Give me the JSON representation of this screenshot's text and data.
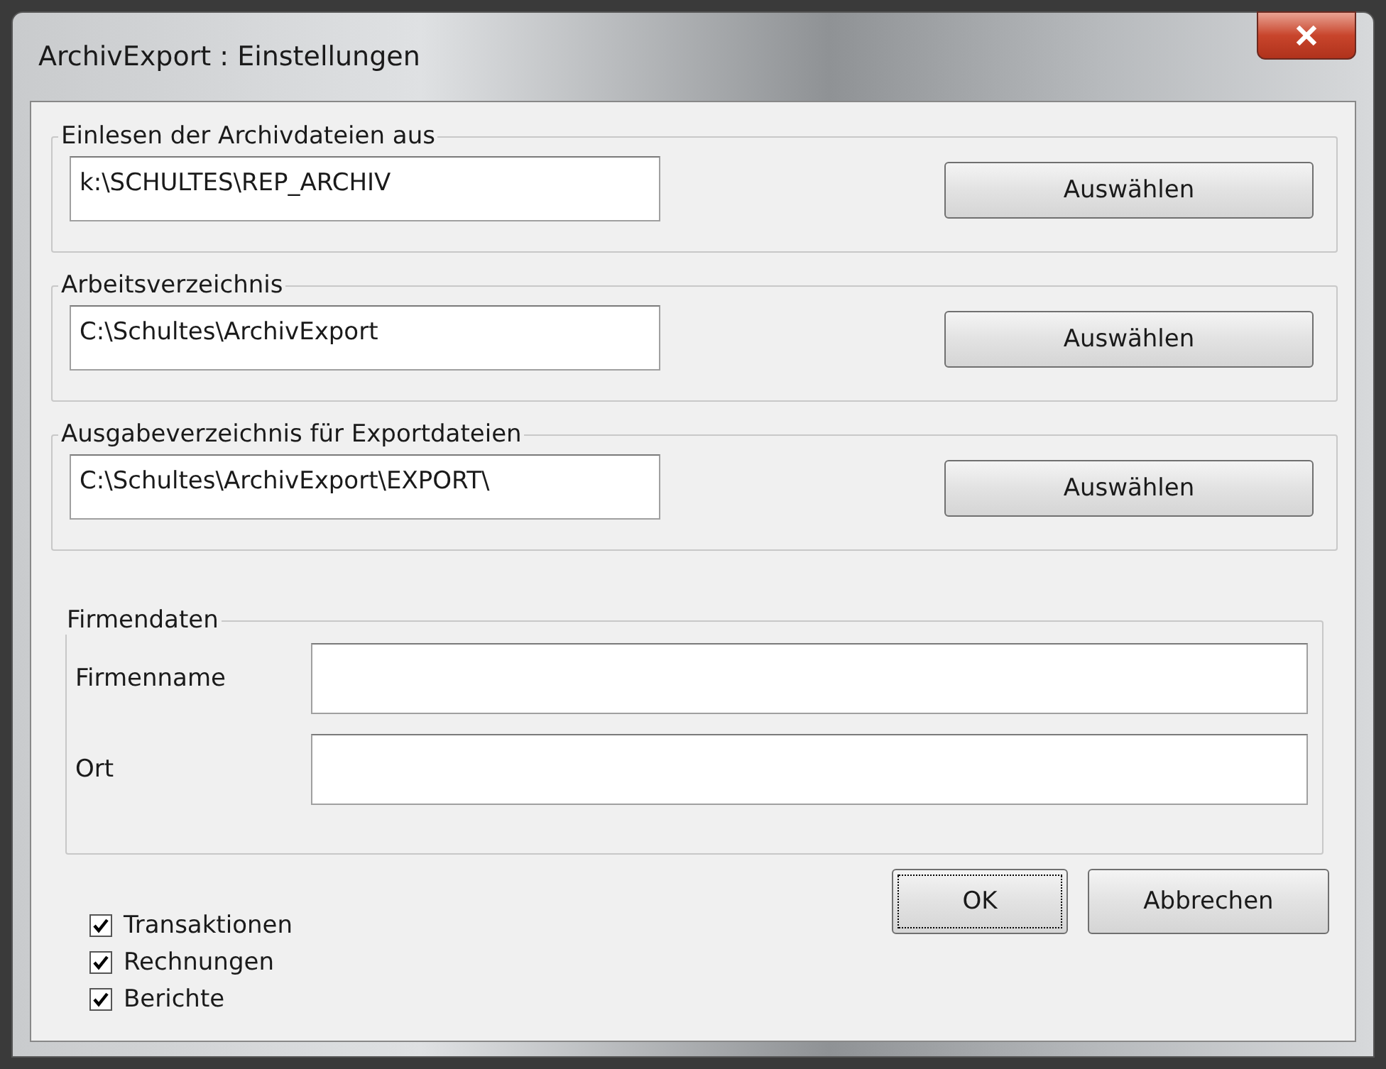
{
  "window": {
    "title": "ArchivExport : Einstellungen"
  },
  "folders": [
    {
      "label": "Einlesen der Archivdateien aus",
      "value": "k:\\SCHULTES\\REP_ARCHIV",
      "button": "Auswählen"
    },
    {
      "label": "Arbeitsverzeichnis",
      "value": "C:\\Schultes\\ArchivExport",
      "button": "Auswählen"
    },
    {
      "label": "Ausgabeverzeichnis für Exportdateien",
      "value": "C:\\Schultes\\ArchivExport\\EXPORT\\",
      "button": "Auswählen"
    }
  ],
  "company": {
    "title": "Firmendaten",
    "fields": [
      {
        "label": "Firmenname"
      },
      {
        "label": "Ort"
      }
    ]
  },
  "options": [
    {
      "label": "Transaktionen",
      "checked": true
    },
    {
      "label": "Rechnungen",
      "checked": true
    },
    {
      "label": "Berichte",
      "checked": true
    }
  ],
  "buttons": [
    {
      "label": "OK",
      "focused": true
    },
    {
      "label": "Abbrechen",
      "focused": false
    }
  ]
}
